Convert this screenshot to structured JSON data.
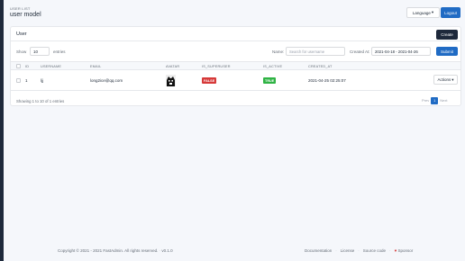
{
  "header": {
    "pretitle": "USER LIST",
    "title": "user model",
    "language_label": "Language",
    "logout_label": "Logout"
  },
  "card": {
    "title": "User",
    "create_label": "Create"
  },
  "filters": {
    "show_label": "Show",
    "page_size": "10",
    "entries_label": "entries",
    "name_label": "Name:",
    "name_placeholder": "Search for username",
    "created_label": "Created At:",
    "created_value": "2021-04-18 - 2021-04-26",
    "submit_label": "Submit"
  },
  "table": {
    "columns": [
      "ID",
      "USERNAME",
      "EMAIL",
      "AVATAR",
      "IS_SUPERUSER",
      "IS_ACTIVE",
      "CREATED_AT"
    ],
    "rows": [
      {
        "id": "1",
        "username": "ljj",
        "email": "long2ice@qq.com",
        "is_superuser": "FALSE",
        "is_active": "TRUE",
        "created_at": "2021-04-25 02:25:07",
        "actions_label": "Actions"
      }
    ],
    "info": "Showing 1 to 10 of 1 entries"
  },
  "pagination": {
    "prev": "Prev",
    "current": "1",
    "next": "Next"
  },
  "footer": {
    "copyright": "Copyright © 2021 - 2021 FastAdmin. All rights reserved.",
    "version": "v0.1.0",
    "links": [
      "Documentation",
      "License",
      "Source code",
      "Sponsor"
    ]
  },
  "colors": {
    "primary": "#206bc4",
    "dark": "#1e293b",
    "false_badge": "#d63939",
    "true_badge": "#2fb344"
  },
  "icons": {
    "language_caret": "chevron-down-icon",
    "actions_caret": "chevron-down-icon",
    "sponsor": "heart-icon",
    "avatar": "user-avatar-image"
  }
}
